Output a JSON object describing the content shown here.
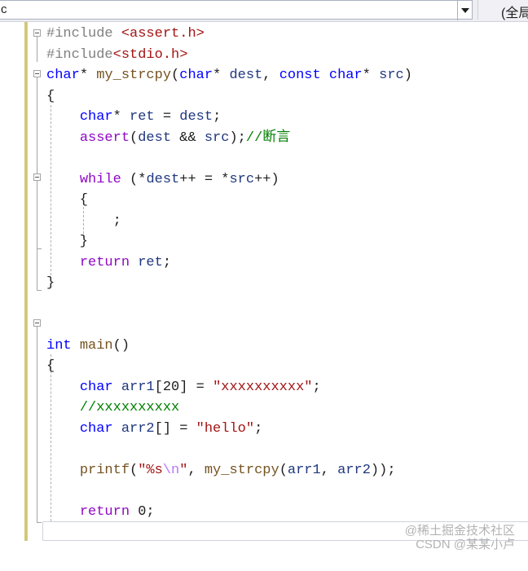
{
  "toolbar": {
    "file_dropdown_value": "c",
    "scope_label": "(全局"
  },
  "code": {
    "lines": [
      [
        {
          "t": "#include ",
          "c": "pp"
        },
        {
          "t": "<assert.h>",
          "c": "str"
        }
      ],
      [
        {
          "t": "#include",
          "c": "pp"
        },
        {
          "t": "<stdio.h>",
          "c": "str"
        }
      ],
      [
        {
          "t": "char",
          "c": "kw"
        },
        {
          "t": "* ",
          "c": ""
        },
        {
          "t": "my_strcpy",
          "c": "fn"
        },
        {
          "t": "(",
          "c": ""
        },
        {
          "t": "char",
          "c": "kw"
        },
        {
          "t": "* ",
          "c": ""
        },
        {
          "t": "dest",
          "c": "id"
        },
        {
          "t": ", ",
          "c": ""
        },
        {
          "t": "const",
          "c": "kw"
        },
        {
          "t": " ",
          "c": ""
        },
        {
          "t": "char",
          "c": "kw"
        },
        {
          "t": "* ",
          "c": ""
        },
        {
          "t": "src",
          "c": "id"
        },
        {
          "t": ")",
          "c": ""
        }
      ],
      [
        {
          "t": "{",
          "c": ""
        }
      ],
      [
        {
          "t": "    ",
          "c": ""
        },
        {
          "t": "char",
          "c": "kw"
        },
        {
          "t": "* ",
          "c": ""
        },
        {
          "t": "ret",
          "c": "id"
        },
        {
          "t": " = ",
          "c": ""
        },
        {
          "t": "dest",
          "c": "id"
        },
        {
          "t": ";",
          "c": ""
        }
      ],
      [
        {
          "t": "    ",
          "c": ""
        },
        {
          "t": "assert",
          "c": "kw2"
        },
        {
          "t": "(",
          "c": ""
        },
        {
          "t": "dest",
          "c": "id"
        },
        {
          "t": " && ",
          "c": ""
        },
        {
          "t": "src",
          "c": "id"
        },
        {
          "t": ");",
          "c": ""
        },
        {
          "t": "//断言",
          "c": "cmt"
        }
      ],
      [],
      [
        {
          "t": "    ",
          "c": ""
        },
        {
          "t": "while",
          "c": "kw2"
        },
        {
          "t": " (*",
          "c": ""
        },
        {
          "t": "dest",
          "c": "id"
        },
        {
          "t": "++ = *",
          "c": ""
        },
        {
          "t": "src",
          "c": "id"
        },
        {
          "t": "++)",
          "c": ""
        }
      ],
      [
        {
          "t": "    {",
          "c": ""
        }
      ],
      [
        {
          "t": "        ;",
          "c": ""
        }
      ],
      [
        {
          "t": "    }",
          "c": ""
        }
      ],
      [
        {
          "t": "    ",
          "c": ""
        },
        {
          "t": "return",
          "c": "kw2"
        },
        {
          "t": " ",
          "c": ""
        },
        {
          "t": "ret",
          "c": "id"
        },
        {
          "t": ";",
          "c": ""
        }
      ],
      [
        {
          "t": "}",
          "c": ""
        }
      ],
      [],
      [],
      [
        {
          "t": "int",
          "c": "kw"
        },
        {
          "t": " ",
          "c": ""
        },
        {
          "t": "main",
          "c": "fn"
        },
        {
          "t": "()",
          "c": ""
        }
      ],
      [
        {
          "t": "{",
          "c": ""
        }
      ],
      [
        {
          "t": "    ",
          "c": ""
        },
        {
          "t": "char",
          "c": "kw"
        },
        {
          "t": " ",
          "c": ""
        },
        {
          "t": "arr1",
          "c": "id"
        },
        {
          "t": "[20] = ",
          "c": ""
        },
        {
          "t": "\"xxxxxxxxxx\"",
          "c": "str"
        },
        {
          "t": ";",
          "c": ""
        }
      ],
      [
        {
          "t": "    ",
          "c": ""
        },
        {
          "t": "//xxxxxxxxxx",
          "c": "cmt"
        }
      ],
      [
        {
          "t": "    ",
          "c": ""
        },
        {
          "t": "char",
          "c": "kw"
        },
        {
          "t": " ",
          "c": ""
        },
        {
          "t": "arr2",
          "c": "id"
        },
        {
          "t": "[] = ",
          "c": ""
        },
        {
          "t": "\"hello\"",
          "c": "str"
        },
        {
          "t": ";",
          "c": ""
        }
      ],
      [],
      [
        {
          "t": "    ",
          "c": ""
        },
        {
          "t": "printf",
          "c": "fn"
        },
        {
          "t": "(",
          "c": ""
        },
        {
          "t": "\"%s",
          "c": "str"
        },
        {
          "t": "\\n",
          "c": "esc"
        },
        {
          "t": "\"",
          "c": "str"
        },
        {
          "t": ", ",
          "c": ""
        },
        {
          "t": "my_strcpy",
          "c": "fn"
        },
        {
          "t": "(",
          "c": ""
        },
        {
          "t": "arr1",
          "c": "id"
        },
        {
          "t": ", ",
          "c": ""
        },
        {
          "t": "arr2",
          "c": "id"
        },
        {
          "t": "));",
          "c": ""
        }
      ],
      [],
      [
        {
          "t": "    ",
          "c": ""
        },
        {
          "t": "return",
          "c": "kw2"
        },
        {
          "t": " 0;",
          "c": ""
        }
      ],
      [
        {
          "t": "}",
          "c": ""
        }
      ]
    ]
  },
  "watermark": {
    "line1": "@稀土掘金技术社区",
    "line2": "CSDN @某某小卢"
  }
}
